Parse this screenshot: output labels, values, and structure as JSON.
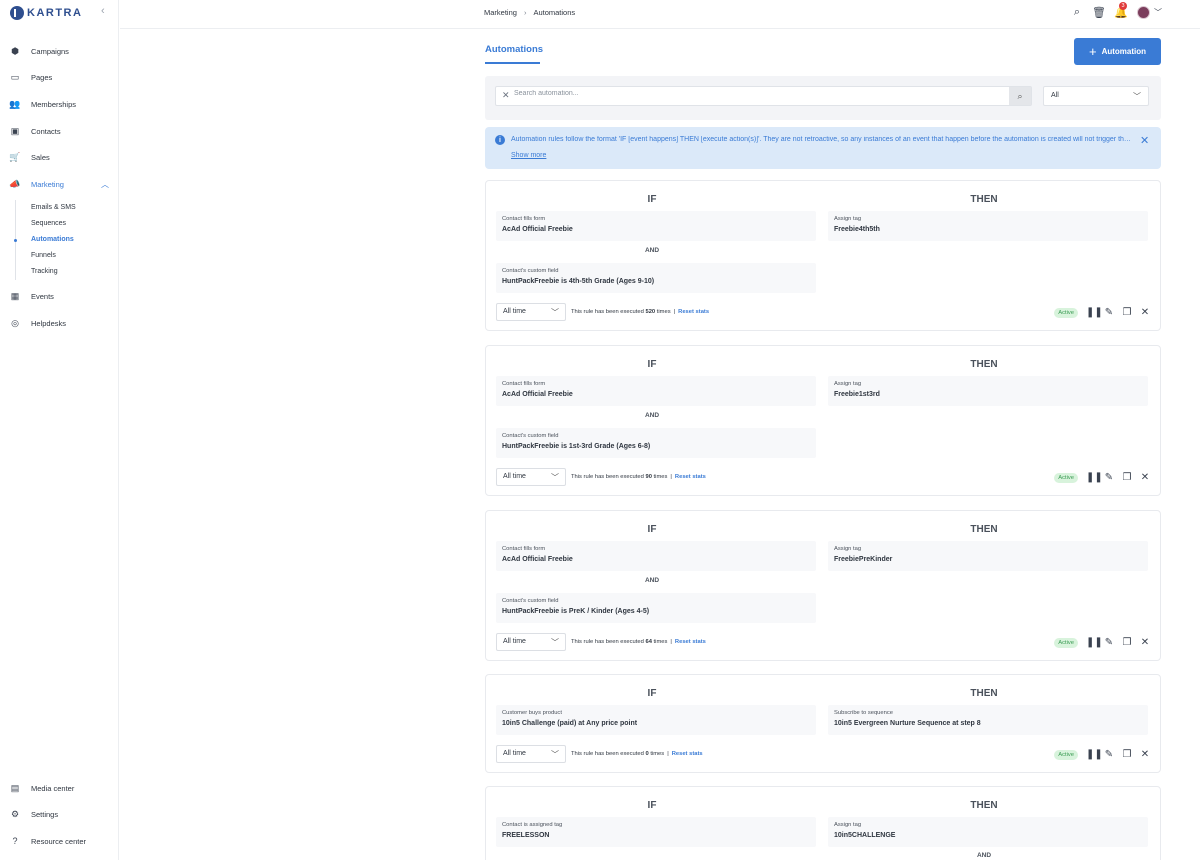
{
  "brand": {
    "name": "KARTRA"
  },
  "sidebar": {
    "items": [
      {
        "label": "Campaigns",
        "icon": "cube-icon"
      },
      {
        "label": "Pages",
        "icon": "browser-icon"
      },
      {
        "label": "Memberships",
        "icon": "people-icon"
      },
      {
        "label": "Contacts",
        "icon": "contact-card-icon"
      },
      {
        "label": "Sales",
        "icon": "cart-icon"
      },
      {
        "label": "Marketing",
        "icon": "megaphone-icon"
      }
    ],
    "marketing_sub": [
      "Emails & SMS",
      "Sequences",
      "Automations",
      "Funnels",
      "Tracking"
    ],
    "items_after": [
      {
        "label": "Events",
        "icon": "calendar-icon"
      },
      {
        "label": "Helpdesks",
        "icon": "lifebuoy-icon"
      }
    ],
    "bottom": [
      {
        "label": "Media center",
        "icon": "media-icon"
      },
      {
        "label": "Settings",
        "icon": "gear-icon"
      },
      {
        "label": "Resource center",
        "icon": "help-icon"
      }
    ]
  },
  "topbar": {
    "breadcrumb": [
      "Marketing",
      "Automations"
    ],
    "notifications": "3"
  },
  "page": {
    "tab": "Automations",
    "add_button": "Automation",
    "search_placeholder": "Search automation...",
    "filter_value": "All",
    "info_text": "Automation rules follow the format 'IF [event happens] THEN [execute action(s)]'. They are not retroactive, so any instances of an event that happen before the automation is created will not trigger the automation.",
    "info_more": "Show more"
  },
  "labels": {
    "if": "IF",
    "then": "THEN",
    "and": "AND",
    "time": "All time",
    "exec_prefix": "This rule has been executed",
    "exec_suffix": "times",
    "reset": "Reset stats",
    "active": "Active"
  },
  "rules": [
    {
      "if1_label": "Contact fills form",
      "if1_value": "AcAd Official Freebie",
      "if2_label": "Contact's custom field",
      "if2_value": "HuntPackFreebie is 4th-5th Grade (Ages 9-10)",
      "then1_label": "Assign tag",
      "then1_value": "Freebie4th5th",
      "count": "520"
    },
    {
      "if1_label": "Contact fills form",
      "if1_value": "AcAd Official Freebie",
      "if2_label": "Contact's custom field",
      "if2_value": "HuntPackFreebie is 1st-3rd Grade (Ages 6-8)",
      "then1_label": "Assign tag",
      "then1_value": "Freebie1st3rd",
      "count": "90"
    },
    {
      "if1_label": "Contact fills form",
      "if1_value": "AcAd Official Freebie",
      "if2_label": "Contact's custom field",
      "if2_value": "HuntPackFreebie is PreK / Kinder (Ages 4-5)",
      "then1_label": "Assign tag",
      "then1_value": "FreebiePreKinder",
      "count": "64"
    },
    {
      "if1_label": "Customer buys product",
      "if1_value": "10in5 Challenge (paid) at Any price point",
      "then1_label": "Subscribe to sequence",
      "then1_value": "10in5 Evergreen Nurture Sequence at step 8",
      "count": "0"
    },
    {
      "if1_label": "Contact is assigned tag",
      "if1_value": "FREELESSON",
      "then1_label": "Assign tag",
      "then1_value": "10in5CHALLENGE"
    }
  ]
}
